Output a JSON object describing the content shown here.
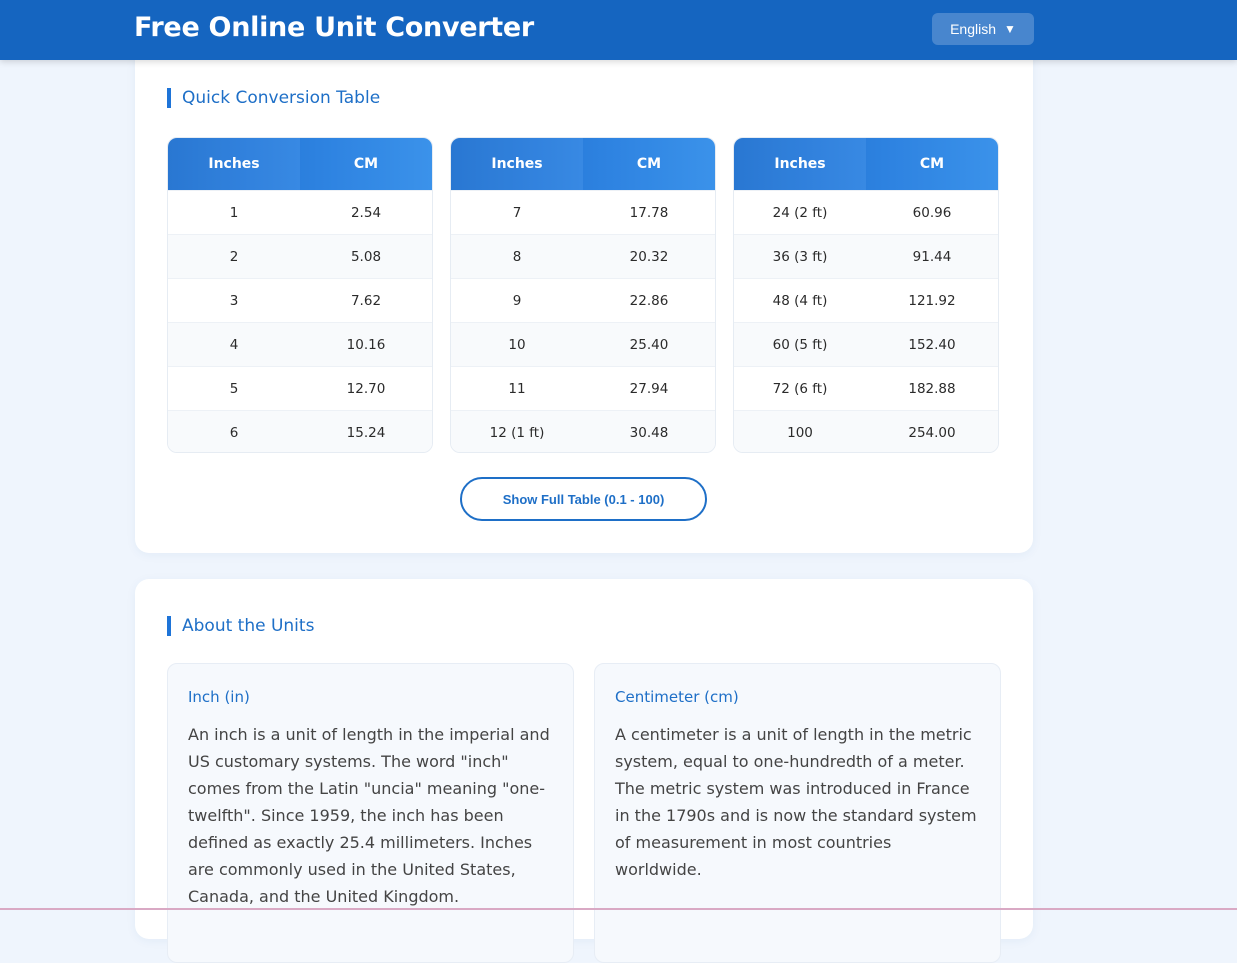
{
  "header": {
    "title": "Free Online Unit Converter",
    "language": "English",
    "language_caret": "▼"
  },
  "quick_table": {
    "title": "Quick Conversion Table",
    "col_from": "Inches",
    "col_to": "CM",
    "tables": [
      {
        "rows": [
          [
            "1",
            "2.54"
          ],
          [
            "2",
            "5.08"
          ],
          [
            "3",
            "7.62"
          ],
          [
            "4",
            "10.16"
          ],
          [
            "5",
            "12.70"
          ],
          [
            "6",
            "15.24"
          ]
        ]
      },
      {
        "rows": [
          [
            "7",
            "17.78"
          ],
          [
            "8",
            "20.32"
          ],
          [
            "9",
            "22.86"
          ],
          [
            "10",
            "25.40"
          ],
          [
            "11",
            "27.94"
          ],
          [
            "12 (1 ft)",
            "30.48"
          ]
        ]
      },
      {
        "rows": [
          [
            "24 (2 ft)",
            "60.96"
          ],
          [
            "36 (3 ft)",
            "91.44"
          ],
          [
            "48 (4 ft)",
            "121.92"
          ],
          [
            "60 (5 ft)",
            "152.40"
          ],
          [
            "72 (6 ft)",
            "182.88"
          ],
          [
            "100",
            "254.00"
          ]
        ]
      }
    ],
    "show_full_label": "Show Full Table (0.1 - 100)"
  },
  "about": {
    "title": "About the Units",
    "units": [
      {
        "name": "Inch (in)",
        "description": "An inch is a unit of length in the imperial and US customary systems. The word \"inch\" comes from the Latin \"uncia\" meaning \"one-twelfth\". Since 1959, the inch has been defined as exactly 25.4 millimeters. Inches are commonly used in the United States, Canada, and the United Kingdom."
      },
      {
        "name": "Centimeter (cm)",
        "description": "A centimeter is a unit of length in the metric system, equal to one-hundredth of a meter. The metric system was introduced in France in the 1790s and is now the standard system of measurement in most countries worldwide."
      }
    ]
  },
  "colors": {
    "header_bg": "#1565c0",
    "accent": "#1e6fc7",
    "page_bg": "#eff5fd"
  }
}
